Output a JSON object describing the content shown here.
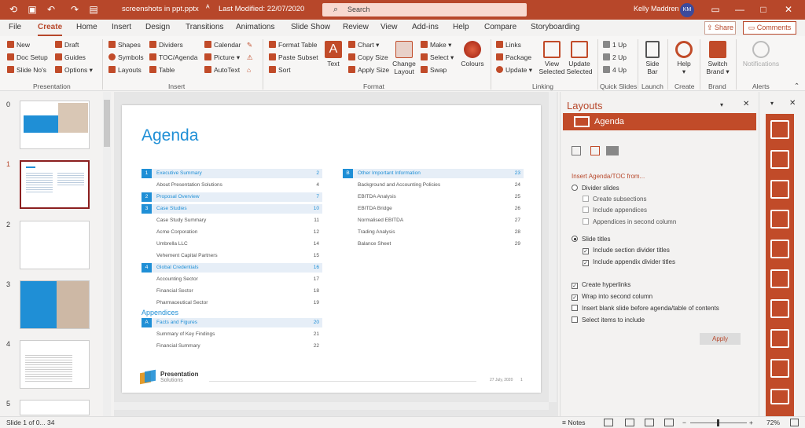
{
  "titlebar": {
    "filename": "screenshots in ppt.pptx",
    "saved_marker": "ᴬ",
    "last_modified": "Last Modified: 22/07/2020",
    "search_placeholder": "Search",
    "user_name": "Kelly Maddren",
    "user_initials": "KM"
  },
  "menu": {
    "tabs": [
      "File",
      "Create",
      "Home",
      "Insert",
      "Design",
      "Transitions",
      "Animations",
      "Slide Show",
      "Review",
      "View",
      "Add-ins",
      "Help",
      "Compare",
      "Storyboarding"
    ],
    "share": "Share",
    "comments": "Comments"
  },
  "ribbon": {
    "presentation": {
      "new": "New",
      "draft": "Draft",
      "doc_setup": "Doc Setup",
      "guides": "Guides",
      "slide_nos": "Slide No's",
      "options": "Options",
      "label": "Presentation"
    },
    "insert": {
      "shapes": "Shapes",
      "dividers": "Dividers",
      "calendar": "Calendar",
      "symbols": "Symbols",
      "toc_agenda": "TOC/Agenda",
      "picture": "Picture",
      "layouts": "Layouts",
      "table": "Table",
      "autotext": "AutoText",
      "label": "Insert"
    },
    "format": {
      "format_table": "Format Table",
      "text": "Text",
      "chart": "Chart",
      "change_layout": "Change Layout",
      "make": "Make",
      "colours": "Colours",
      "paste_subset": "Paste Subset",
      "copy_size": "Copy Size",
      "select": "Select",
      "sort": "Sort",
      "apply_size": "Apply Size",
      "swap": "Swap",
      "label": "Format"
    },
    "linking": {
      "links": "Links",
      "package": "Package",
      "update": "Update",
      "view_selected": "View Selected",
      "update_selected": "Update Selected",
      "label": "Linking"
    },
    "quick_slides": {
      "one_up": "1 Up",
      "two_up": "2 Up",
      "four_up": "4 Up",
      "label": "Quick Slides"
    },
    "launch": {
      "side_bar": "Side Bar",
      "label": "Launch"
    },
    "create": {
      "help": "Help",
      "label": "Create"
    },
    "brand": {
      "switch_brand": "Switch Brand",
      "label": "Brand"
    },
    "alerts": {
      "notifications": "Notifications",
      "label": "Alerts"
    }
  },
  "thumbnails": [
    "0",
    "1",
    "2",
    "3",
    "4",
    "5"
  ],
  "slide": {
    "title": "Agenda",
    "left_items": [
      {
        "num": "1",
        "label": "Executive Summary",
        "page": "2",
        "main": true
      },
      {
        "label": "About Presentation Solutions",
        "page": "4",
        "main": false
      },
      {
        "num": "2",
        "label": "Proposal Overview",
        "page": "7",
        "main": true
      },
      {
        "num": "3",
        "label": "Case Studies",
        "page": "10",
        "main": true
      },
      {
        "label": "Case Study Summary",
        "page": "11",
        "main": false
      },
      {
        "label": "Acme Corporation",
        "page": "12",
        "main": false
      },
      {
        "label": "Umbrella LLC",
        "page": "14",
        "main": false
      },
      {
        "label": "Vehement Capital Partners",
        "page": "15",
        "main": false
      },
      {
        "num": "4",
        "label": "Global Credentials",
        "page": "16",
        "main": true
      },
      {
        "label": "Accounting Sector",
        "page": "17",
        "main": false
      },
      {
        "label": "Financial Sector",
        "page": "18",
        "main": false
      },
      {
        "label": "Pharmaceutical Sector",
        "page": "19",
        "main": false
      }
    ],
    "appendices_title": "Appendices",
    "appendix_items": [
      {
        "num": "A",
        "label": "Facts and Figures",
        "page": "20",
        "main": true
      },
      {
        "label": "Summary of Key Findings",
        "page": "21",
        "main": false
      },
      {
        "label": "Financial Summary",
        "page": "22",
        "main": false
      }
    ],
    "right_items": [
      {
        "num": "B",
        "label": "Other Important Information",
        "page": "23",
        "main": true
      },
      {
        "label": "Background and Accounting Policies",
        "page": "24",
        "main": false
      },
      {
        "label": "EBITDA Analysis",
        "page": "25",
        "main": false
      },
      {
        "label": "EBITDA Bridge",
        "page": "26",
        "main": false
      },
      {
        "label": "Normalised EBITDA",
        "page": "27",
        "main": false
      },
      {
        "label": "Trading Analysis",
        "page": "28",
        "main": false
      },
      {
        "label": "Balance Sheet",
        "page": "29",
        "main": false
      }
    ],
    "logo_line1": "Presentation",
    "logo_line2": "Solutions",
    "footer_date": "27 July, 2020",
    "footer_page": "1"
  },
  "panel": {
    "title": "Layouts",
    "header": "Agenda",
    "section_label": "Insert Agenda/TOC from...",
    "divider_slides": "Divider slides",
    "create_subsections": "Create subsections",
    "include_appendices": "Include appendices",
    "appendices_second_column": "Appendices in second column",
    "slide_titles": "Slide titles",
    "include_section_dividers": "Include section divider titles",
    "include_appendix_dividers": "Include appendix divider titles",
    "create_hyperlinks": "Create hyperlinks",
    "wrap_second_column": "Wrap into second column",
    "insert_blank": "Insert blank slide before agenda/table of contents",
    "select_items": "Select items to include",
    "apply": "Apply"
  },
  "status": {
    "slide_info": "Slide 1 of 0... 34",
    "notes": "Notes",
    "zoom": "72%"
  },
  "colors": {
    "accent": "#b7472a",
    "slide_blue": "#1f8fd6"
  }
}
